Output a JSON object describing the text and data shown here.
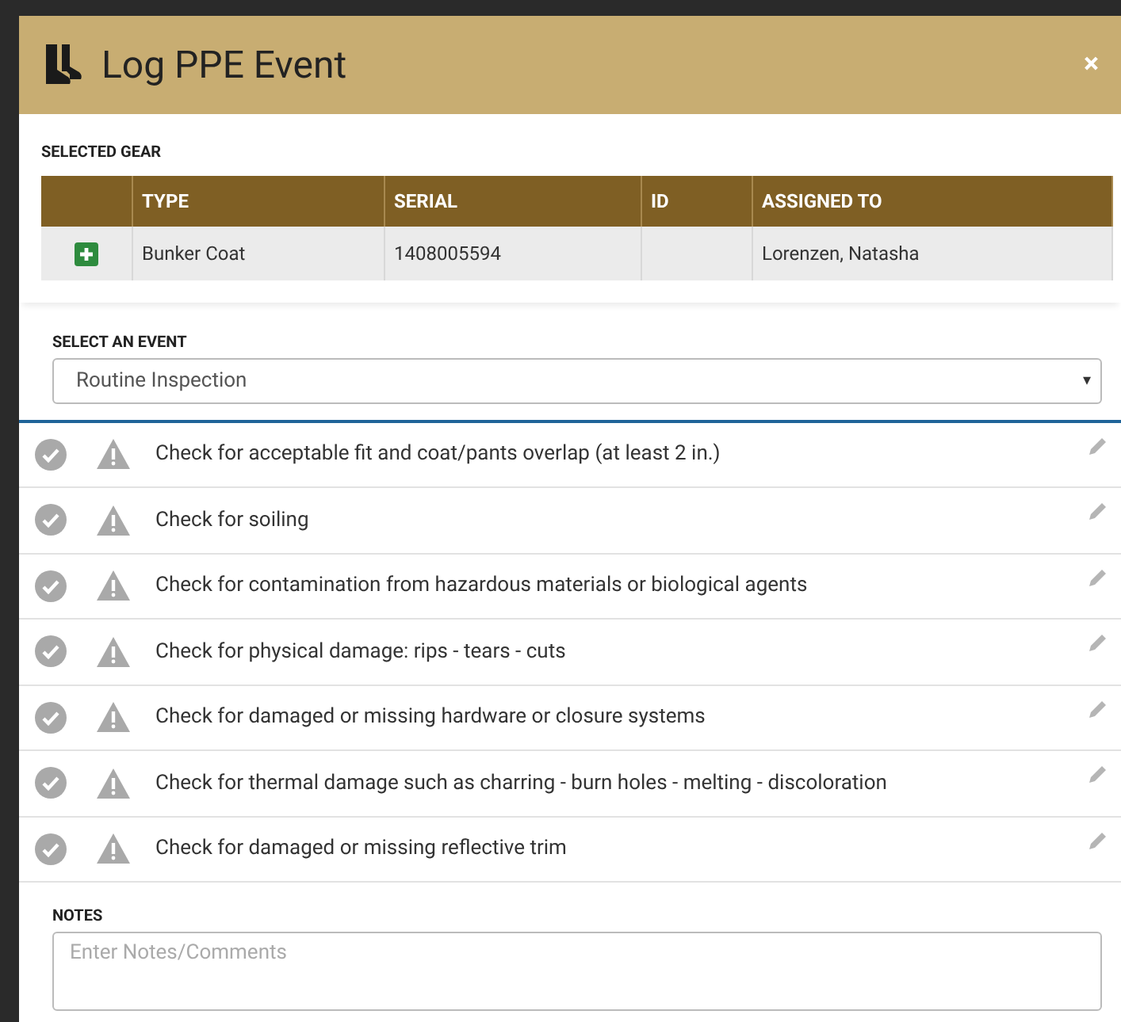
{
  "dialog": {
    "title": "Log PPE Event",
    "close": "×"
  },
  "selected_gear": {
    "label": "SELECTED GEAR",
    "columns": [
      "TYPE",
      "SERIAL",
      "ID",
      "ASSIGNED TO"
    ],
    "rows": [
      {
        "cells": [
          "Bunker Coat",
          "1408005594",
          "",
          "Lorenzen, Natasha"
        ]
      }
    ]
  },
  "event": {
    "label": "SELECT AN EVENT",
    "value": "Routine Inspection",
    "caret": "▾"
  },
  "checks": [
    {
      "text": "Check for acceptable fit and coat/pants overlap (at least 2 in.)"
    },
    {
      "text": "Check for soiling"
    },
    {
      "text": "Check for contamination from hazardous materials or biological agents"
    },
    {
      "text": "Check for physical damage: rips - tears - cuts"
    },
    {
      "text": "Check for damaged or missing hardware or closure systems"
    },
    {
      "text": "Check for thermal damage such as charring - burn holes - melting - discoloration"
    },
    {
      "text": "Check for damaged or missing reflective trim"
    }
  ],
  "notes": {
    "label": "NOTES",
    "placeholder": "Enter Notes/Comments"
  }
}
